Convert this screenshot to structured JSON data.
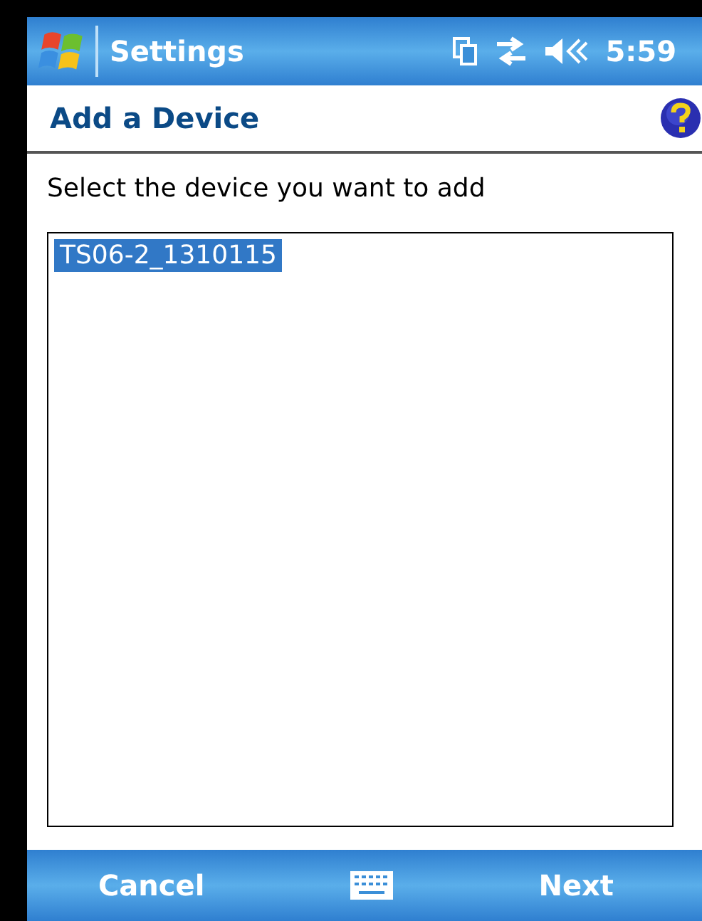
{
  "title_bar": {
    "title": "Settings",
    "time": "5:59"
  },
  "header": {
    "title": "Add a Device"
  },
  "instruction": "Select the device you want to add",
  "devices": [
    {
      "label": "TS06-2_1310115",
      "selected": true
    }
  ],
  "menu_bar": {
    "left": "Cancel",
    "right": "Next"
  }
}
